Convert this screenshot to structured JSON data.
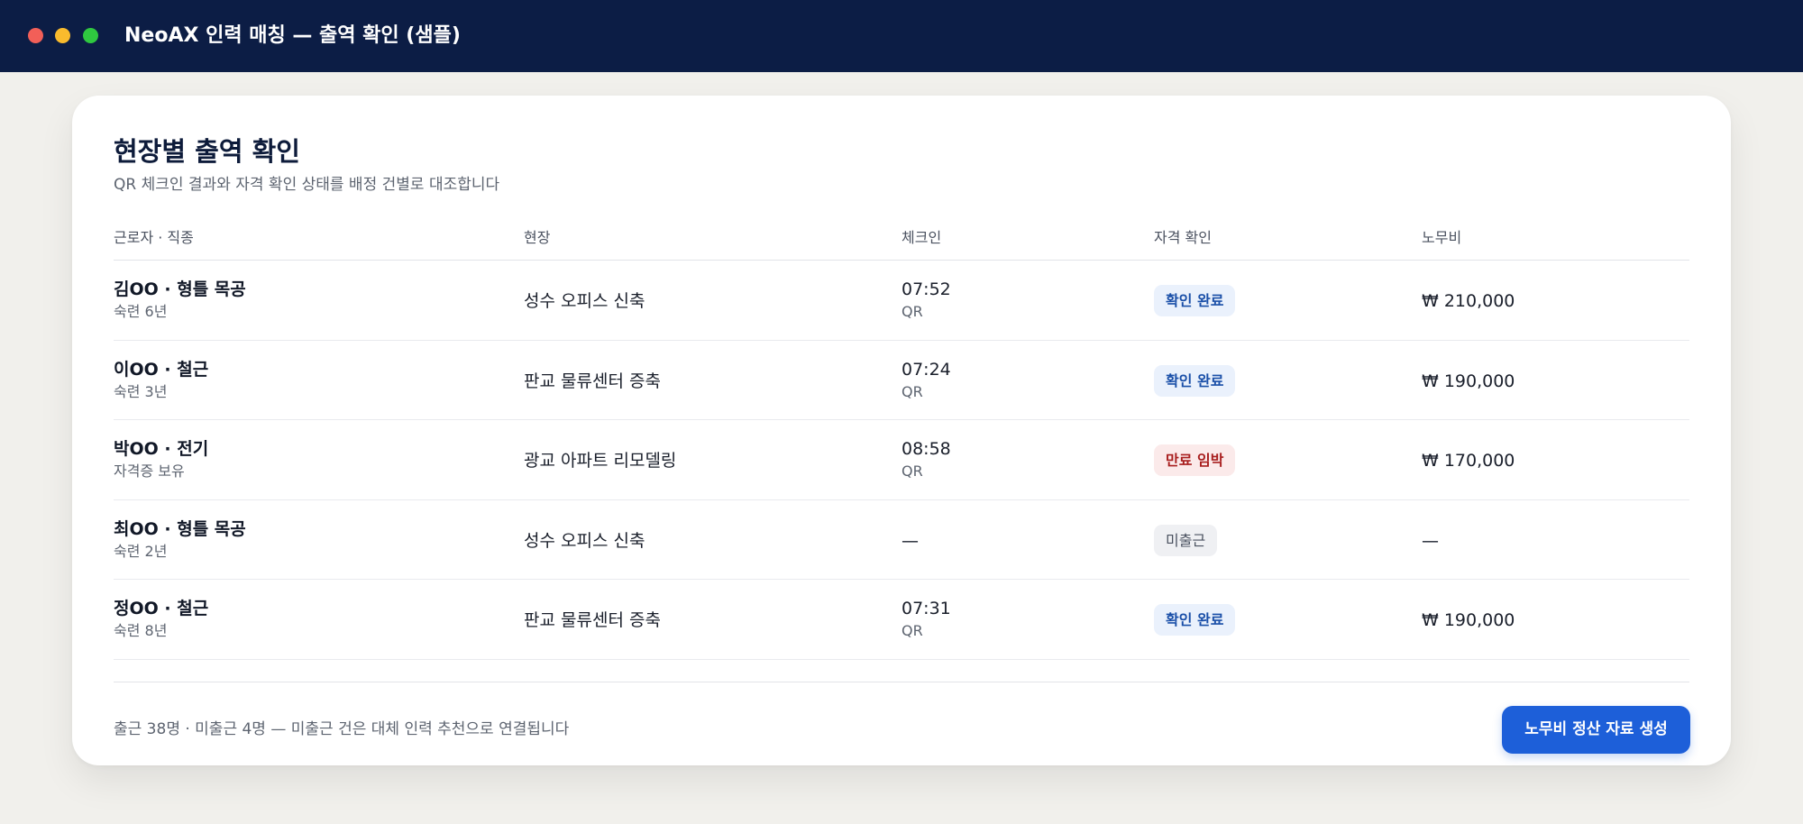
{
  "window": {
    "title": "NeoAX 인력 매칭 — 출역 확인 (샘플)"
  },
  "header": {
    "title": "현장별 출역 확인",
    "subtitle": "QR 체크인 결과와 자격 확인 상태를 배정 건별로 대조합니다"
  },
  "table": {
    "columns": [
      "근로자 · 직종",
      "현장",
      "체크인",
      "자격 확인",
      "노무비"
    ],
    "rows": [
      {
        "name": "김OO · 형틀 목공",
        "sub": "숙련 6년",
        "site": "성수 오피스 신축",
        "time": "07:52",
        "method": "QR",
        "status": "확인 완료",
        "status_kind": "ok",
        "pay": "₩ 210,000"
      },
      {
        "name": "이OO · 철근",
        "sub": "숙련 3년",
        "site": "판교 물류센터 증축",
        "time": "07:24",
        "method": "QR",
        "status": "확인 완료",
        "status_kind": "ok",
        "pay": "₩ 190,000"
      },
      {
        "name": "박OO · 전기",
        "sub": "자격증 보유",
        "site": "광교 아파트 리모델링",
        "time": "08:58",
        "method": "QR",
        "status": "만료 임박",
        "status_kind": "warn",
        "pay": "₩ 170,000"
      },
      {
        "name": "최OO · 형틀 목공",
        "sub": "숙련 2년",
        "site": "성수 오피스 신축",
        "time": "—",
        "method": "",
        "status": "미출근",
        "status_kind": "none",
        "pay": "—"
      },
      {
        "name": "정OO · 철근",
        "sub": "숙련 8년",
        "site": "판교 물류센터 증축",
        "time": "07:31",
        "method": "QR",
        "status": "확인 완료",
        "status_kind": "ok",
        "pay": "₩ 190,000"
      }
    ]
  },
  "footer": {
    "summary": "출근 38명 · 미출근 4명 — 미출근 건은 대체 인력 추천으로 연결됩니다",
    "button_label": "노무비 정산 자료 생성"
  },
  "colors": {
    "titlebar": "#0c1d45",
    "accent": "#1d5fd9",
    "ok_badge_bg": "#eaf1fc",
    "warn_badge_bg": "#fbeaea",
    "none_badge_bg": "#eff0f3"
  }
}
